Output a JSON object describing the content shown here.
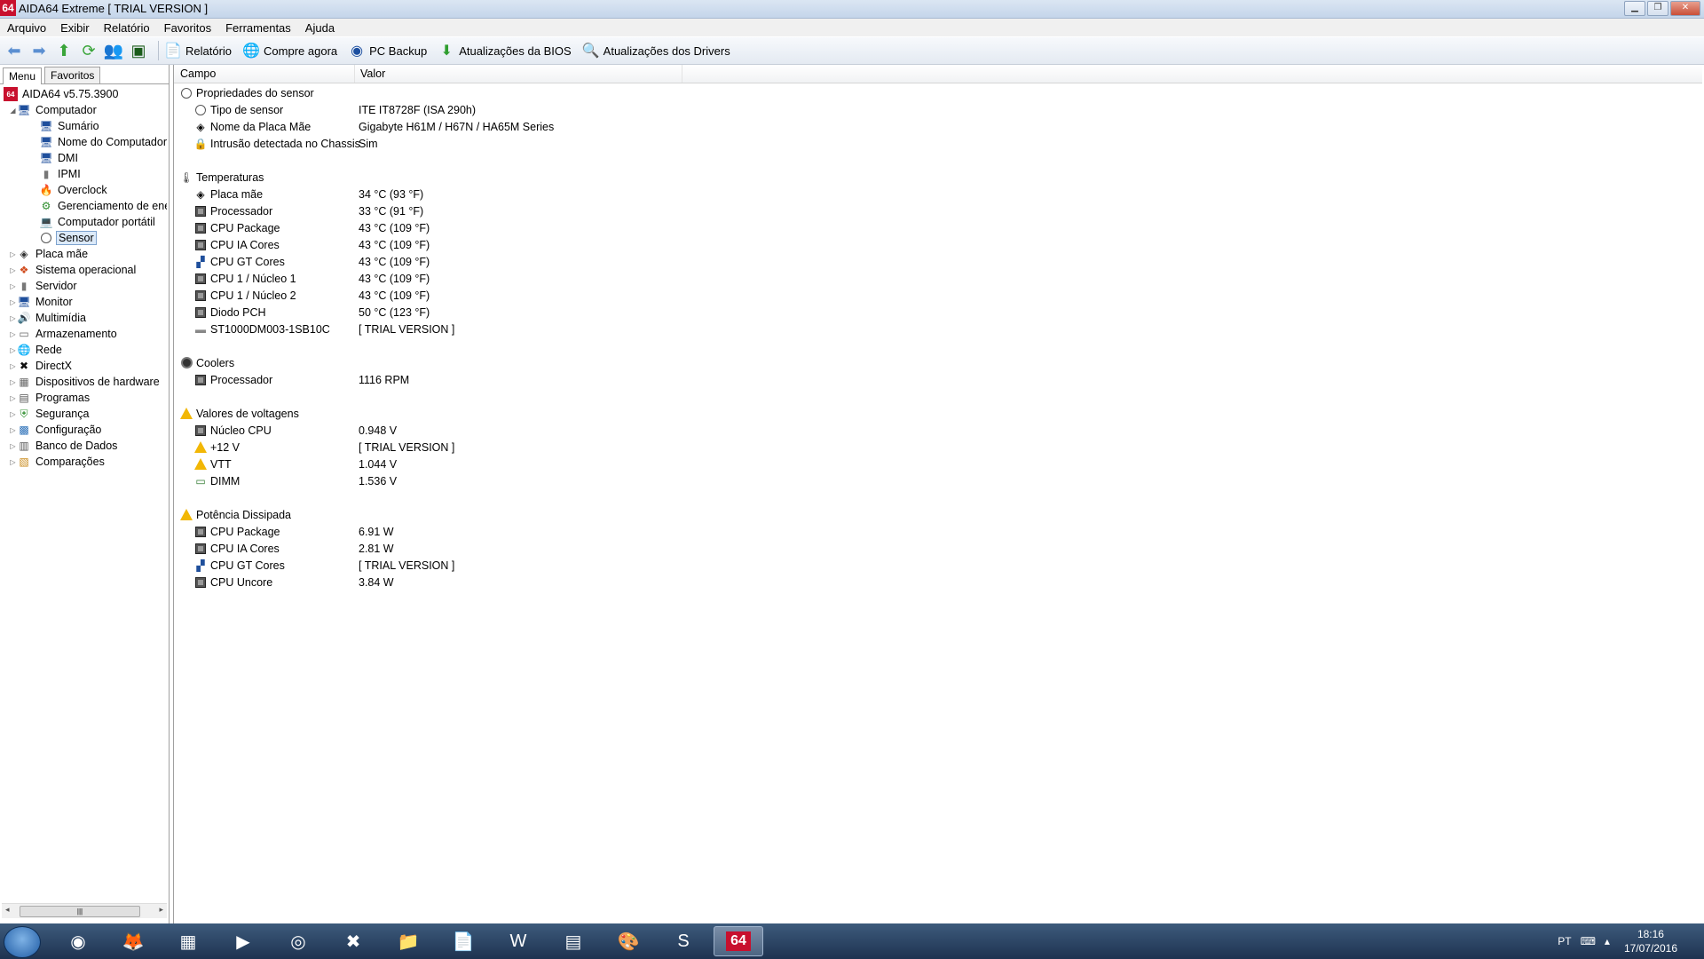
{
  "window": {
    "title": "AIDA64 Extreme  [ TRIAL VERSION ]",
    "app_icon_text": "64"
  },
  "menubar": [
    "Arquivo",
    "Exibir",
    "Relatório",
    "Favoritos",
    "Ferramentas",
    "Ajuda"
  ],
  "toolbar": {
    "report": "Relatório",
    "buy": "Compre agora",
    "backup": "PC Backup",
    "bios": "Atualizações da BIOS",
    "drivers": "Atualizações dos Drivers"
  },
  "left": {
    "tab_menu": "Menu",
    "tab_favorites": "Favoritos",
    "root": "AIDA64 v5.75.3900",
    "computer": "Computador",
    "computer_children": [
      "Sumário",
      "Nome do Computador",
      "DMI",
      "IPMI",
      "Overclock",
      "Gerenciamento de ener",
      "Computador portátil",
      "Sensor"
    ],
    "categories": [
      "Placa mãe",
      "Sistema operacional",
      "Servidor",
      "Monitor",
      "Multimídia",
      "Armazenamento",
      "Rede",
      "DirectX",
      "Dispositivos de hardware",
      "Programas",
      "Segurança",
      "Configuração",
      "Banco de Dados",
      "Comparações"
    ]
  },
  "columns": {
    "field": "Campo",
    "value": "Valor"
  },
  "sections": {
    "props": {
      "title": "Propriedades do sensor",
      "rows": [
        {
          "field": "Tipo de sensor",
          "value": "ITE IT8728F  (ISA 290h)"
        },
        {
          "field": "Nome da Placa Mãe",
          "value": "Gigabyte H61M / H67N / HA65M Series"
        },
        {
          "field": "Intrusão detectada no Chassis",
          "value": "Sim"
        }
      ]
    },
    "temps": {
      "title": "Temperaturas",
      "rows": [
        {
          "field": "Placa mãe",
          "value": "34 °C  (93 °F)"
        },
        {
          "field": "Processador",
          "value": "33 °C  (91 °F)"
        },
        {
          "field": "CPU Package",
          "value": "43 °C  (109 °F)"
        },
        {
          "field": "CPU IA Cores",
          "value": "43 °C  (109 °F)"
        },
        {
          "field": "CPU GT Cores",
          "value": "43 °C  (109 °F)"
        },
        {
          "field": "CPU 1 / Núcleo 1",
          "value": "43 °C  (109 °F)"
        },
        {
          "field": "CPU 1 / Núcleo 2",
          "value": "43 °C  (109 °F)"
        },
        {
          "field": "Diodo PCH",
          "value": "50 °C  (123 °F)"
        },
        {
          "field": "ST1000DM003-1SB10C",
          "value": "[ TRIAL VERSION ]"
        }
      ]
    },
    "coolers": {
      "title": "Coolers",
      "rows": [
        {
          "field": "Processador",
          "value": "1116 RPM"
        }
      ]
    },
    "volts": {
      "title": "Valores de voltagens",
      "rows": [
        {
          "field": "Núcleo CPU",
          "value": "0.948 V"
        },
        {
          "field": "+12 V",
          "value": "[ TRIAL VERSION ]"
        },
        {
          "field": "VTT",
          "value": "1.044 V"
        },
        {
          "field": "DIMM",
          "value": "1.536 V"
        }
      ]
    },
    "power": {
      "title": "Potência Dissipada",
      "rows": [
        {
          "field": "CPU Package",
          "value": "6.91 W"
        },
        {
          "field": "CPU IA Cores",
          "value": "2.81 W"
        },
        {
          "field": "CPU GT Cores",
          "value": "[ TRIAL VERSION ]"
        },
        {
          "field": "CPU Uncore",
          "value": "3.84 W"
        }
      ]
    }
  },
  "taskbar": {
    "lang": "PT",
    "time": "18:16",
    "date": "17/07/2016",
    "active_app_label": "64"
  }
}
